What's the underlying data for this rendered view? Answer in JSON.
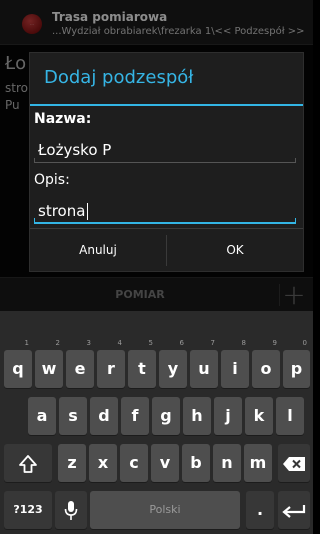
{
  "app": {
    "logo_text": "...",
    "title": "Trasa pomiarowa",
    "subtitle": "...Wydział obrabiarek\\frezarka 1\\<< Podzespół >>",
    "bg_peek": [
      "Ło",
      "stro",
      "Pu"
    ]
  },
  "dialog": {
    "title": "Dodaj podzespół",
    "name_label": "Nazwa:",
    "name_value": "Łożysko P",
    "desc_label": "Opis:",
    "desc_value": "strona",
    "cancel_label": "Anuluj",
    "ok_label": "OK"
  },
  "bottombar": {
    "pomiar_label": "POMIAR",
    "add_symbol": "+"
  },
  "keyboard": {
    "row1": [
      {
        "k": "q",
        "h": "1"
      },
      {
        "k": "w",
        "h": "2"
      },
      {
        "k": "e",
        "h": "3"
      },
      {
        "k": "r",
        "h": "4"
      },
      {
        "k": "t",
        "h": "5"
      },
      {
        "k": "y",
        "h": "6"
      },
      {
        "k": "u",
        "h": "7"
      },
      {
        "k": "i",
        "h": "8"
      },
      {
        "k": "o",
        "h": "9"
      },
      {
        "k": "p",
        "h": "0"
      }
    ],
    "row2": [
      "a",
      "s",
      "d",
      "f",
      "g",
      "h",
      "j",
      "k",
      "l"
    ],
    "row3": [
      "z",
      "x",
      "c",
      "v",
      "b",
      "n",
      "m"
    ],
    "symbols_label": "?123",
    "space_label": "Polski",
    "period_label": "."
  }
}
